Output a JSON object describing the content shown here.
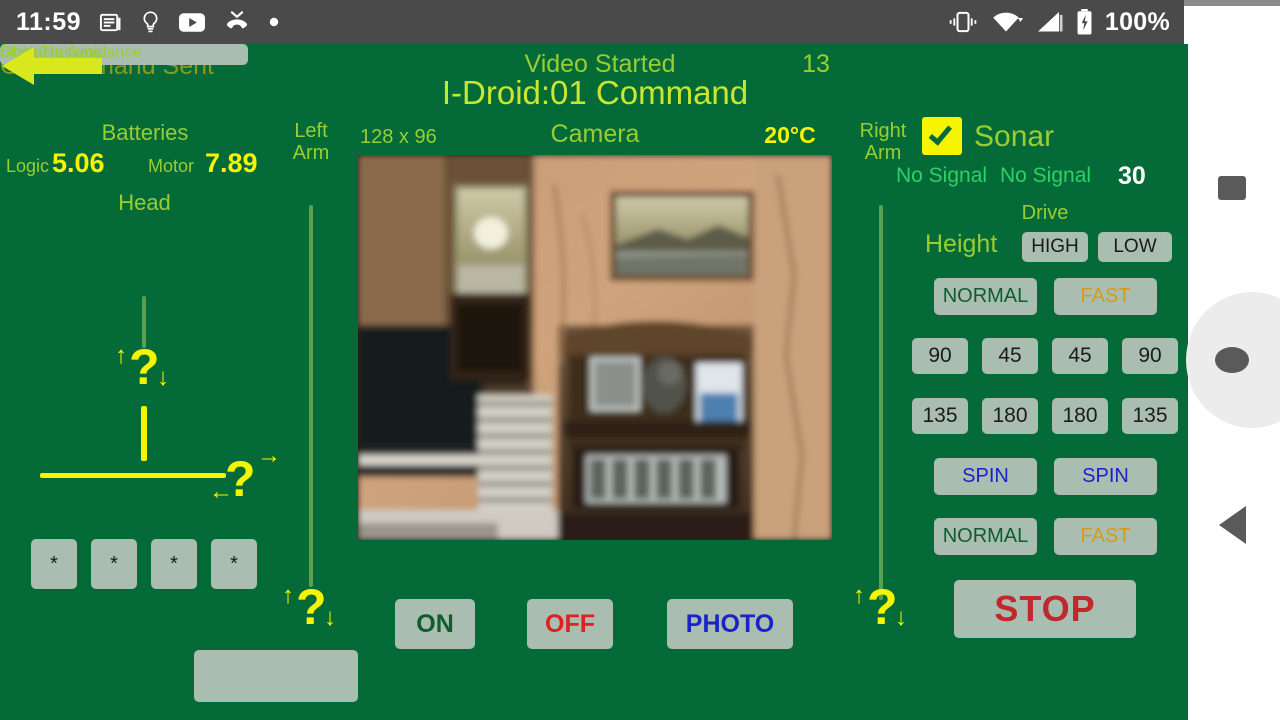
{
  "status_bar": {
    "clock": "11:59",
    "left_icons": [
      "news-icon",
      "lightbulb-icon",
      "youtube-icon",
      "missed-call-icon",
      "dot-icon"
    ],
    "right_icons": [
      "vibrate-icon",
      "wifi-icon",
      "cellular-signal-icon",
      "battery-charging-icon"
    ],
    "battery_percent": "100%"
  },
  "nav_bar": {
    "recents": "recents-square",
    "home": "home-circle",
    "back": "back-triangle"
  },
  "header": {
    "command_status": "On Command Sent",
    "video_status": "Video Started",
    "video_count": "13",
    "title": "I-Droid:01 Command"
  },
  "camera": {
    "resolution": "128 x 96",
    "label": "Camera",
    "temperature": "20°C",
    "image_alt": "live-camera-feed-living-room"
  },
  "batteries": {
    "heading": "Batteries",
    "logic_label": "Logic",
    "logic_value": "5.06",
    "motor_label": "Motor",
    "motor_value": "7.89"
  },
  "head": {
    "label": "Head",
    "tilt_glyph": "up-down-question-arrows",
    "pan_glyph": "left-right-question-arrows"
  },
  "arms": {
    "left_label": "Left\nArm",
    "left_label_line1": "Left",
    "left_label_line2": "Arm",
    "right_label_line1": "Right",
    "right_label_line2": "Arm"
  },
  "sonar": {
    "checked": true,
    "label": "Sonar",
    "reading_left": "No Signal",
    "reading_right": "No Signal",
    "value": "30"
  },
  "drive": {
    "heading": "Drive",
    "height_label": "Height",
    "height_options": [
      "HIGH",
      "LOW"
    ],
    "speed_top": [
      "NORMAL",
      "FAST"
    ],
    "angles_row1": [
      "90",
      "45",
      "45",
      "90"
    ],
    "angles_row2": [
      "135",
      "180",
      "180",
      "135"
    ],
    "spin": [
      "SPIN",
      "SPIN"
    ],
    "speed_bottom": [
      "NORMAL",
      "FAST"
    ],
    "stop_label": "STOP"
  },
  "media_controls": {
    "on": "ON",
    "off": "OFF",
    "photo": "PHOTO"
  },
  "star_buttons": [
    "*",
    "*",
    "*",
    "*"
  ],
  "text_fields": {
    "field1_value": "",
    "field2_value": "",
    "field1_placeholder": "",
    "field2_placeholder": ""
  },
  "toggles": {
    "obstacle_avoidance_label": "Obstacle Avoidance",
    "obstacle_avoidance_checked": false,
    "sight_tracking_label": "Sight Tracking",
    "sight_tracking_checked": false
  },
  "back_arrow": {
    "glyph": "left-arrow"
  },
  "colors": {
    "background_green": "#046b38",
    "title_yellow_green": "#c8e830",
    "label_yellow_green": "#9acd32",
    "value_yellow": "#f5f500",
    "button_gray": "#a9bdb0",
    "status_olive": "#8b9a1f",
    "signal_green": "#2fd06a",
    "red": "#c0282d",
    "blue": "#1a23c8",
    "orange": "#d99a19"
  }
}
